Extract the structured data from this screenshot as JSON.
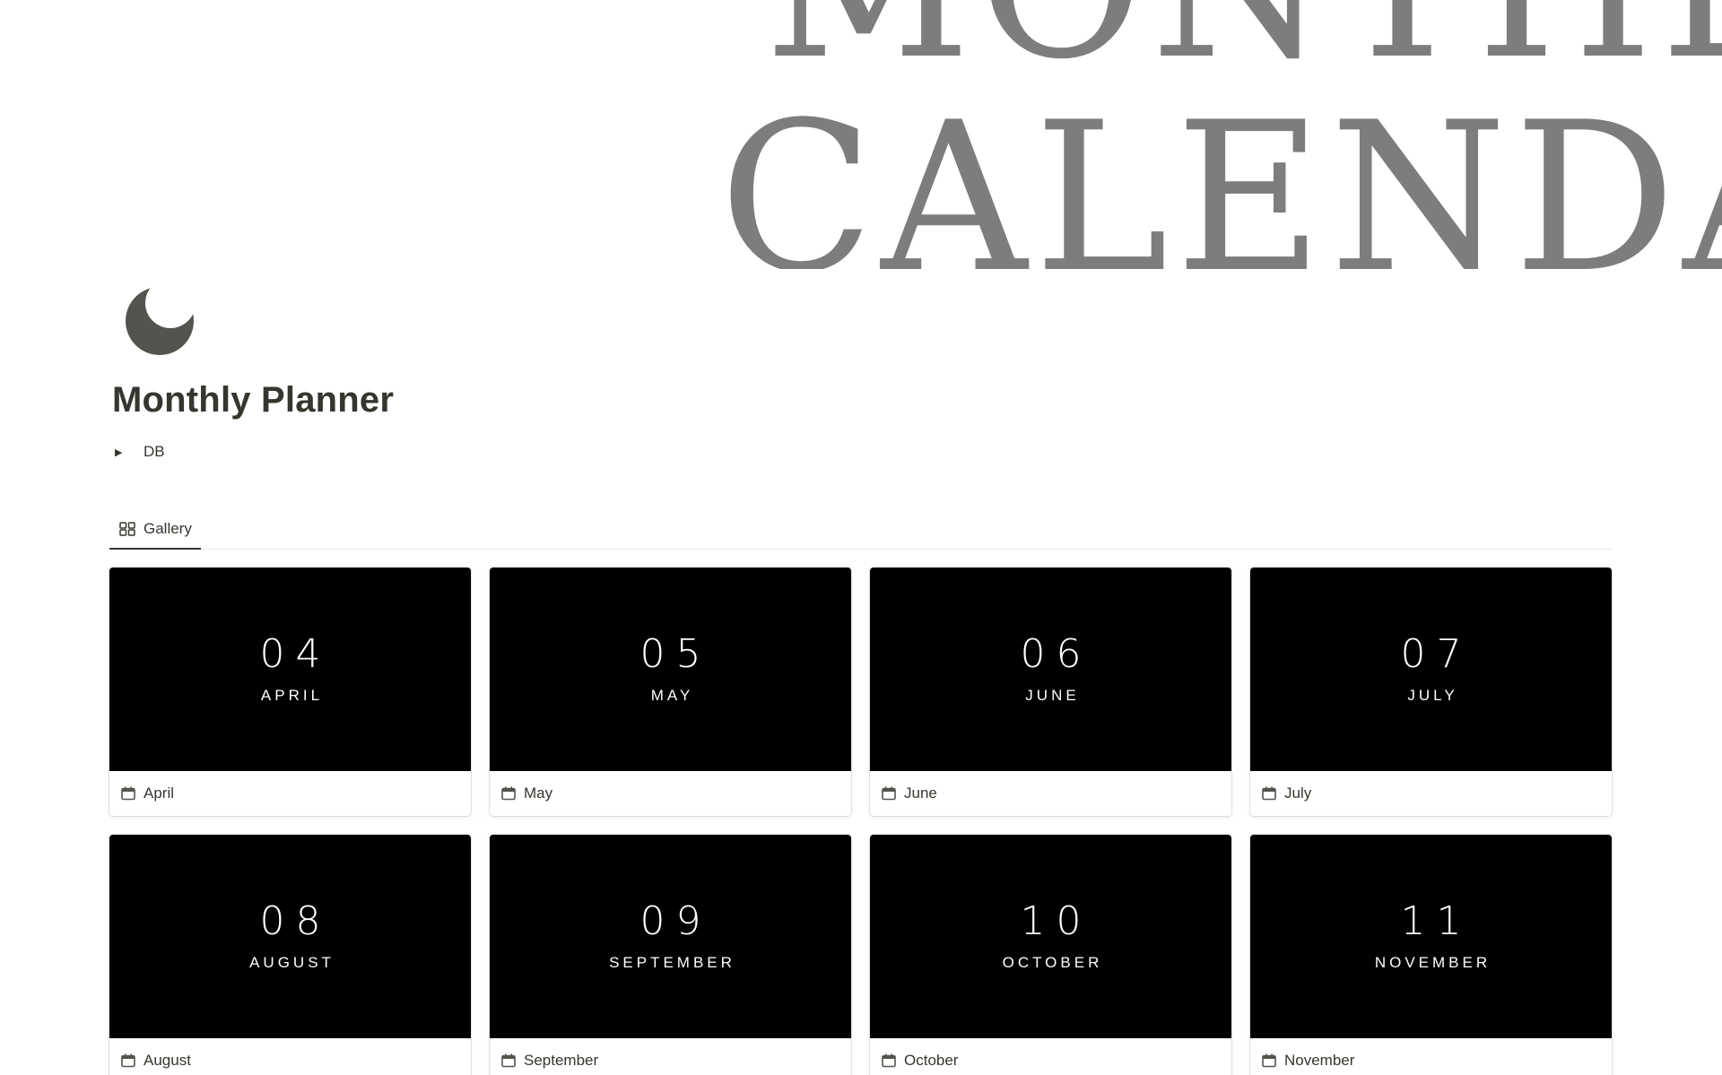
{
  "cover": {
    "line1": "MONTHLY",
    "line2": "CALENDAR"
  },
  "page": {
    "icon": "moon-icon",
    "title": "Monthly Planner"
  },
  "toggle": {
    "label": "DB"
  },
  "tabs": [
    {
      "label": "Gallery",
      "icon": "gallery-grid-icon",
      "active": true
    }
  ],
  "gallery": {
    "cards": [
      {
        "num": "04",
        "month": "APRIL",
        "name": "April"
      },
      {
        "num": "05",
        "month": "MAY",
        "name": "May"
      },
      {
        "num": "06",
        "month": "JUNE",
        "name": "June"
      },
      {
        "num": "07",
        "month": "JULY",
        "name": "July"
      },
      {
        "num": "08",
        "month": "AUGUST",
        "name": "August"
      },
      {
        "num": "09",
        "month": "SEPTEMBER",
        "name": "September"
      },
      {
        "num": "10",
        "month": "OCTOBER",
        "name": "October"
      },
      {
        "num": "11",
        "month": "NOVEMBER",
        "name": "November"
      }
    ],
    "card_icon": "calendar-icon"
  },
  "colors": {
    "text": "#37352f",
    "cover_text": "#7d7d7d",
    "card_cover": "#000000",
    "icon": "#55534e"
  }
}
